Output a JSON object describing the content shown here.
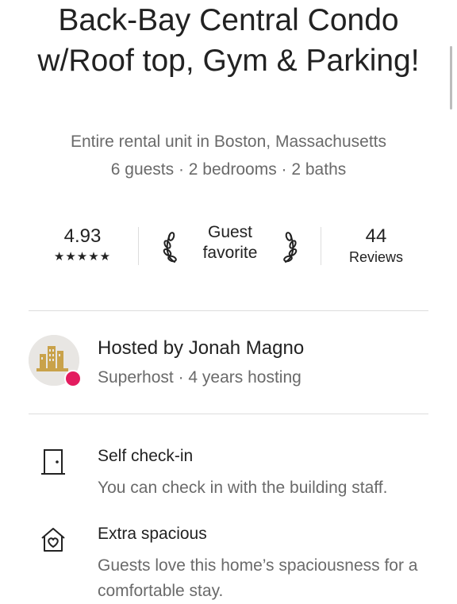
{
  "listing": {
    "title": "Back-Bay Central Condo w/Roof top, Gym & Parking!",
    "subtitle": "Entire rental unit in Boston, Massachusetts",
    "details": "6 guests · 2 bedrooms · 2 baths"
  },
  "stats": {
    "rating": "4.93",
    "stars": "★★★★★",
    "guest_favorite": "Guest favorite",
    "reviews_count": "44",
    "reviews_label": "Reviews"
  },
  "host": {
    "name": "Hosted by Jonah Magno",
    "subtitle": "Superhost · 4 years hosting"
  },
  "features": [
    {
      "icon": "door-icon",
      "title": "Self check-in",
      "description": "You can check in with the building staff."
    },
    {
      "icon": "home-heart-icon",
      "title": "Extra spacious",
      "description": "Guests love this home’s spaciousness for a comfortable stay."
    }
  ],
  "colors": {
    "text": "#222222",
    "secondary": "#6a6a6a",
    "badge": "#e31c5f",
    "divider": "#dddddd"
  }
}
